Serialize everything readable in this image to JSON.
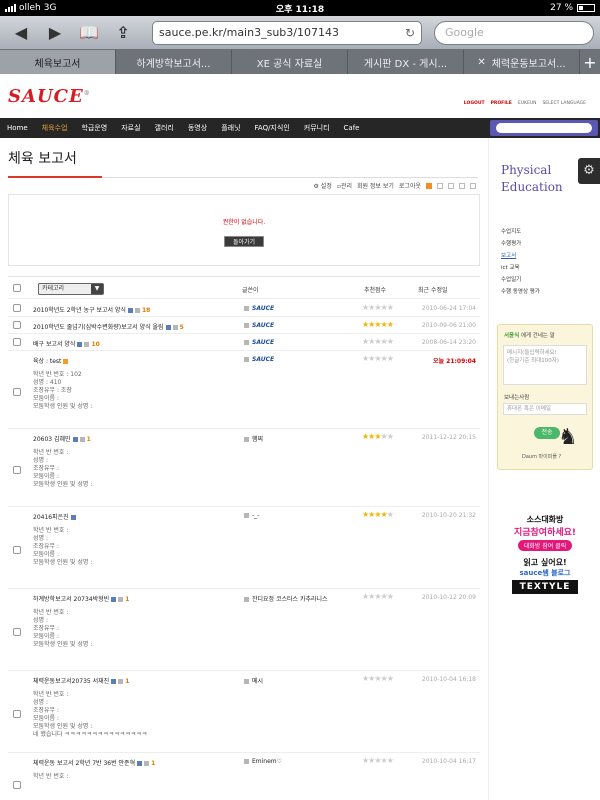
{
  "statusbar": {
    "carrier": "olleh",
    "network": "3G",
    "time": "오후 11:18",
    "battery": "27 %"
  },
  "browser": {
    "url": "sauce.pe.kr/main3_sub3/107143",
    "search_placeholder": "Google",
    "tabs": [
      {
        "label": "체육보고서",
        "active": true
      },
      {
        "label": "하계방학보고서...",
        "active": false
      },
      {
        "label": "XE 공식 자료실",
        "active": false
      },
      {
        "label": "게시판 DX - 게시...",
        "active": false
      },
      {
        "label": "체력운동보고서...",
        "active": false
      }
    ]
  },
  "site": {
    "logo": "SAUCE",
    "toplinks": [
      "LOGOUT",
      "PROFILE",
      "EUKEUN",
      "SELECT LANGUAGE"
    ],
    "nav": [
      "Home",
      "체육수업",
      "학급운영",
      "자료실",
      "갤러리",
      "동영상",
      "플래닛",
      "FAQ/지식인",
      "커뮤니티",
      "Cafe"
    ],
    "nav_active": 1
  },
  "page": {
    "title": "체육 보고서",
    "toolbar": [
      "설정",
      "관리",
      "회원 정보 보기",
      "로그아웃"
    ],
    "permission_msg": "권한이 없습니다.",
    "back_button": "돌아가기"
  },
  "list": {
    "category_label": "카테고리",
    "col_author": "글쓴이",
    "col_rating": "추천점수",
    "col_date": "최근 수정일",
    "rows": [
      {
        "title": "2010학년도 2학년 농구 보고서 양식",
        "count": "18",
        "author": "SAUCE",
        "stars": 0,
        "date": "2010-06-24 17:04"
      },
      {
        "title": "2010학년도 줄넘기(심박수변화량)보고서 양식 올림",
        "count": "5",
        "author": "SAUCE",
        "stars": 5,
        "date": "2010-09-06 21:00"
      },
      {
        "title": "배구 보고서 양식",
        "count": "10",
        "author": "SAUCE",
        "stars": 0,
        "date": "2008-06-14 23:20"
      },
      {
        "title": "육상 : test",
        "count": "",
        "author": "SAUCE",
        "stars": 0,
        "date": "오늘 21:09:04",
        "red": true,
        "body": [
          "학년 반 번호 : 102",
          "성명 : 410",
          "조장유무 : 조장",
          "모둠이름 :",
          "모둠학생 인원 및 성명 :"
        ]
      },
      {
        "title": "20603 김혜민",
        "count": "1",
        "author": "햄찌",
        "stars": 3,
        "date": "2011-12-12 20:15",
        "body": [
          "학년 반 번호 :",
          "성명 :",
          "조장유무 :",
          "모둠이름 :",
          "모둠학생 인원 및 성명 :"
        ]
      },
      {
        "title": "20416피은진",
        "count": "",
        "author": "-_-",
        "stars": 3.5,
        "date": "2010-10-20 21:32",
        "body": [
          "학년 반 번호 :",
          "성명 :",
          "조장유무 :",
          "모둠이름 :",
          "모둠학생 인원 및 성명 :"
        ]
      },
      {
        "title": "하계방학보고서 20734박형빈",
        "count": "1",
        "author": "잔디요정 코스타스 카추라니스",
        "stars": 0,
        "date": "2010-10-12 20:09",
        "body": [
          "학년 반 번호 :",
          "성명 :",
          "조장유무 :",
          "모둠이름 :",
          "모둠학생 인원 및 성명 :"
        ]
      },
      {
        "title": "체력운동보고서20735 서재진",
        "count": "1",
        "author": "메시",
        "stars": 0,
        "date": "2010-10-04 16:18",
        "body": [
          "학년 반 번호 :",
          "성명 :",
          "조장유무 :",
          "모둠이름 :",
          "모둠학생 인원 및 성명 :",
          "네 했습니다 ㅋㅋㅋㅋㅋㅋㅋㅋㅋㅋㅋㅋㅋㅋㅋ"
        ]
      },
      {
        "title": "체력운동 보고서 2학년 7반 36번 안준혁",
        "count": "1",
        "author": "Eminem♡",
        "stars": 0,
        "date": "2010-10-04 16:17",
        "body": [
          "학년 반 번호 :"
        ]
      }
    ]
  },
  "sidebar": {
    "heading": [
      "Physical",
      "Education"
    ],
    "menu": [
      "수업지도",
      "수행평가",
      "보고서",
      "ict 교육",
      "수업일기",
      "수행 동영상 평가"
    ],
    "menu_active": 2,
    "memo": {
      "title_prefix": "서윤식",
      "title_suffix": "에게 건네는 말",
      "textarea": [
        "메시지(들입력하세요!",
        "(한글기준 최대100자)"
      ],
      "sender_label": "보내는사람",
      "sender_placeholder": "휴대폰 혹은 이메일",
      "send_button": "전송",
      "footer": "Daum 마이피플 ?"
    },
    "ad": {
      "line1": "소스대화방",
      "line2": "지금참여하세요!",
      "pill": "대화방 참여 클릭",
      "line3": "읽고 싶어요!",
      "line4": "sauce쌤 블로그",
      "brand": "TEXTYLE"
    }
  }
}
